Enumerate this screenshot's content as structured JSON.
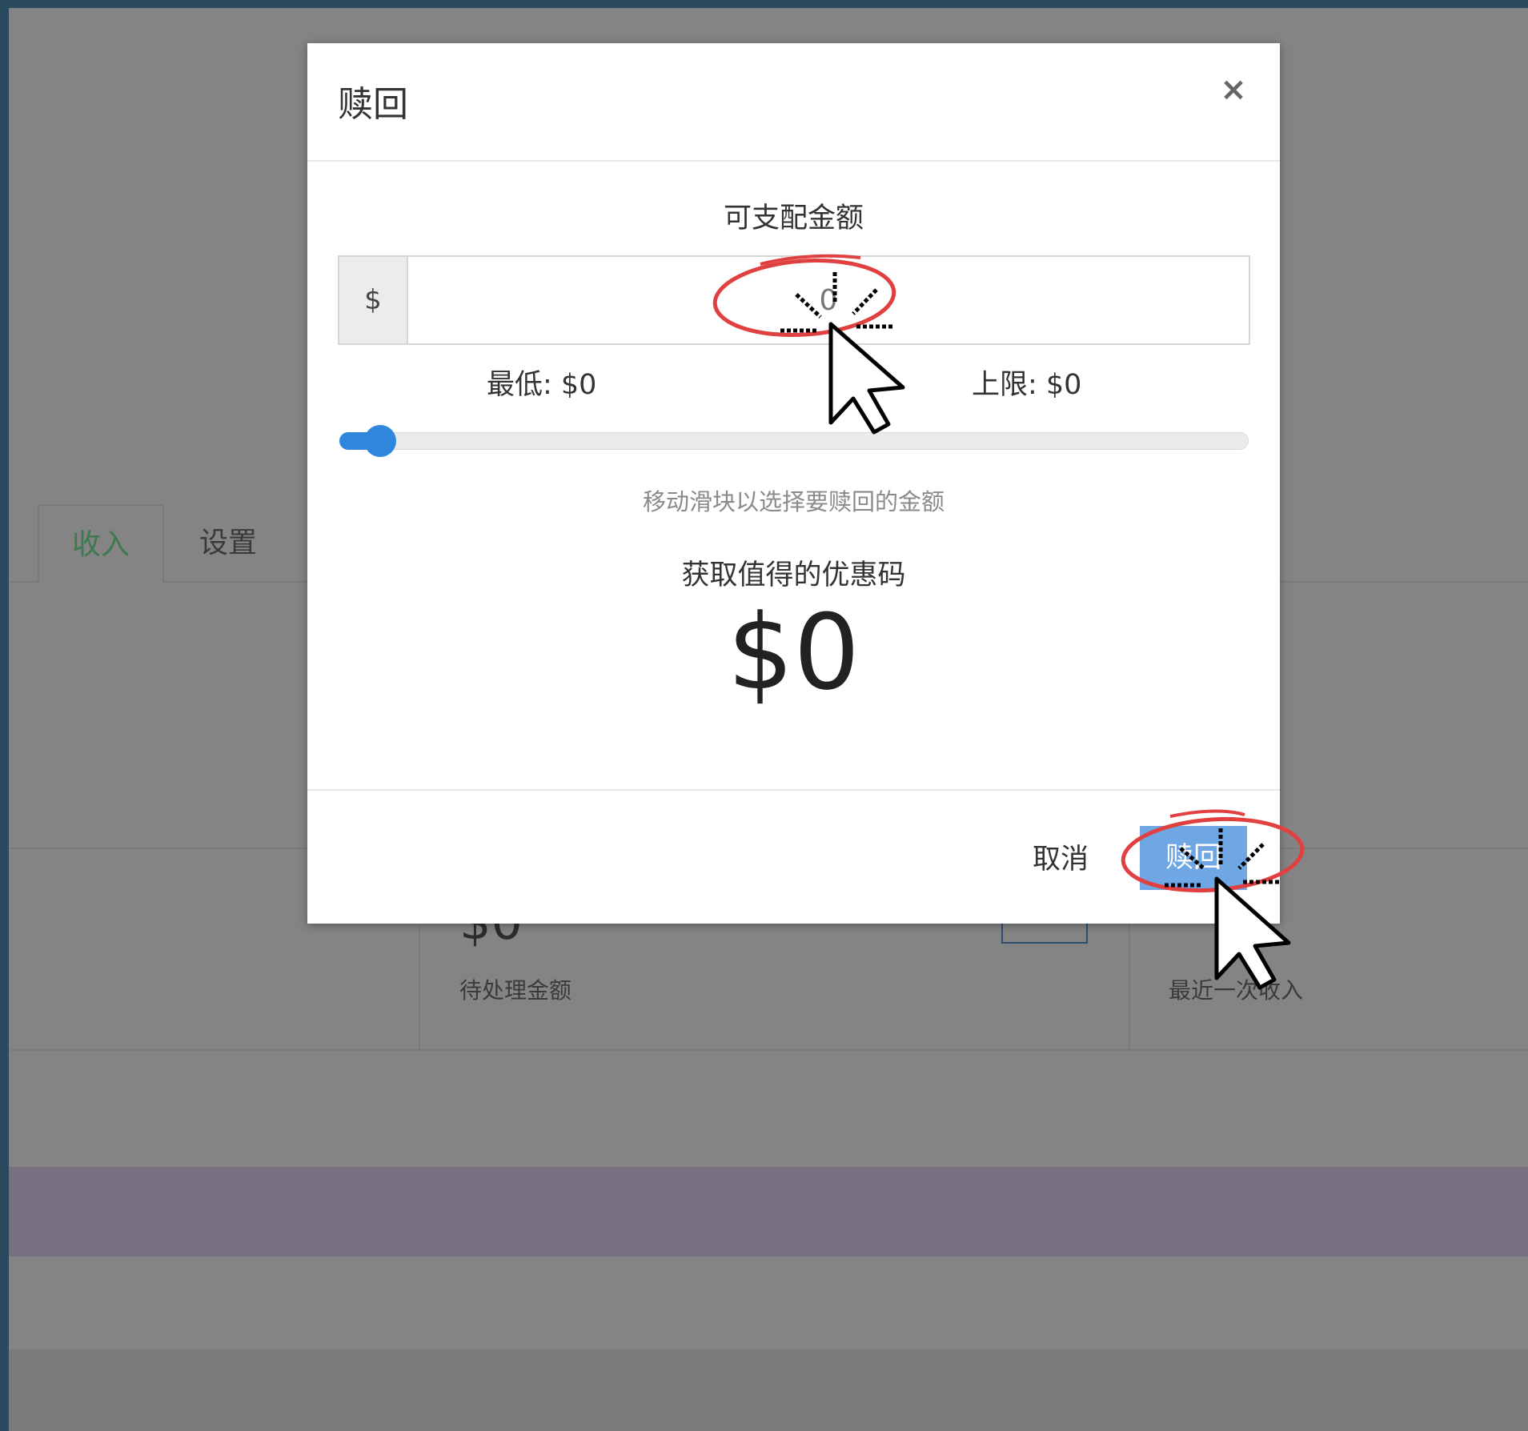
{
  "background_page": {
    "tabs": [
      {
        "label": "收入",
        "active": true
      },
      {
        "label": "设置",
        "active": false
      }
    ],
    "pending_amount": "$0",
    "pending_label": "待处理金额",
    "recent_income_label": "最近一次收入"
  },
  "modal": {
    "title": "赎回",
    "close_icon": "×",
    "available_label": "可支配金额",
    "currency_symbol": "$",
    "amount_value": "0",
    "min_label": "最低: $0",
    "max_label": "上限: $0",
    "slider": {
      "value_fraction": 0.0
    },
    "hint": "移动滑块以选择要赎回的金额",
    "coupon_title": "获取值得的优惠码",
    "coupon_amount": "$0",
    "cancel_label": "取消",
    "redeem_label": "赎回"
  },
  "colors": {
    "accent_blue": "#2f86dd",
    "redeem_button": "#6ea7e3",
    "overlay_gray": "#848484",
    "active_tab_green": "#3d7a4f",
    "annotation_red": "#e0403f"
  }
}
